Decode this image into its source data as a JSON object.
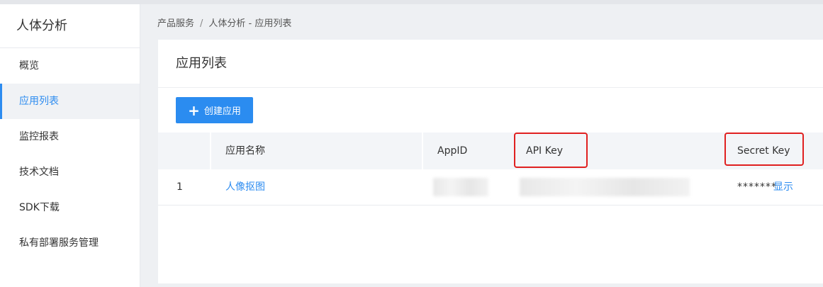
{
  "sidebar": {
    "title": "人体分析",
    "items": [
      {
        "label": "概览"
      },
      {
        "label": "应用列表"
      },
      {
        "label": "监控报表"
      },
      {
        "label": "技术文档"
      },
      {
        "label": "SDK下载"
      },
      {
        "label": "私有部署服务管理"
      }
    ]
  },
  "breadcrumb": {
    "root": "产品服务",
    "separator": "/",
    "current": "人体分析 - 应用列表"
  },
  "panel": {
    "title": "应用列表",
    "create_button": "创建应用",
    "create_icon": "plus-icon"
  },
  "table": {
    "columns": [
      "应用名称",
      "AppID",
      "API Key",
      "Secret Key"
    ],
    "rows": [
      {
        "index": "1",
        "name": "人像抠图",
        "secret": "*******",
        "show_action": "显示"
      }
    ]
  },
  "colors": {
    "accent": "#2d8cf0",
    "highlight": "#e02020"
  }
}
